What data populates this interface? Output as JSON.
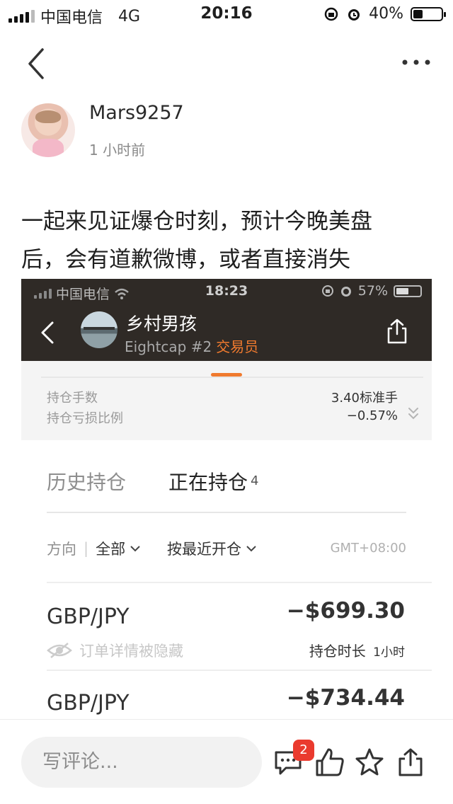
{
  "status_bar": {
    "carrier": "中国电信",
    "network": "4G",
    "time": "20:16",
    "battery": "40%",
    "battery_level": 0.4
  },
  "nav": {
    "back_icon": "chevron-left-icon",
    "more_icon": "more-horizontal-icon"
  },
  "author": {
    "name": "Mars9257",
    "time_ago": "1 小时前"
  },
  "post": {
    "text_line1": "一起来见证爆仓时刻，预计今晚美盘",
    "text_line2": "后，会有道歉微博，或者直接消失"
  },
  "embedded": {
    "status": {
      "carrier": "中国电信",
      "time": "18:23",
      "battery": "57%",
      "battery_level": 0.57
    },
    "user": {
      "name": "乡村男孩",
      "broker": "Eightcap #2",
      "role": "交易员"
    },
    "stats": [
      {
        "label": "持仓手数",
        "value": "3.40标准手"
      },
      {
        "label": "持仓亏损比例",
        "value": "−0.57%"
      }
    ]
  },
  "positions": {
    "tabs": {
      "history": "历史持仓",
      "current": "正在持仓",
      "current_count": "4"
    },
    "filter": {
      "direction_label": "方向",
      "direction_value": "全部",
      "sort": "按最近开仓",
      "timezone": "GMT+08:00"
    },
    "rows": [
      {
        "pair": "GBP/JPY",
        "pnl": "−$699.30",
        "hidden_note": "订单详情被隐藏",
        "hold_label": "持仓时长",
        "hold_value": "1小时"
      },
      {
        "pair": "GBP/JPY",
        "pnl": "−$734.44"
      }
    ]
  },
  "bottom_bar": {
    "comment_placeholder": "写评论...",
    "comment_count": "2"
  },
  "colors": {
    "accent_orange": "#f07a2e",
    "badge_red": "#ea3a2e",
    "embed_header": "#2f2a26"
  }
}
